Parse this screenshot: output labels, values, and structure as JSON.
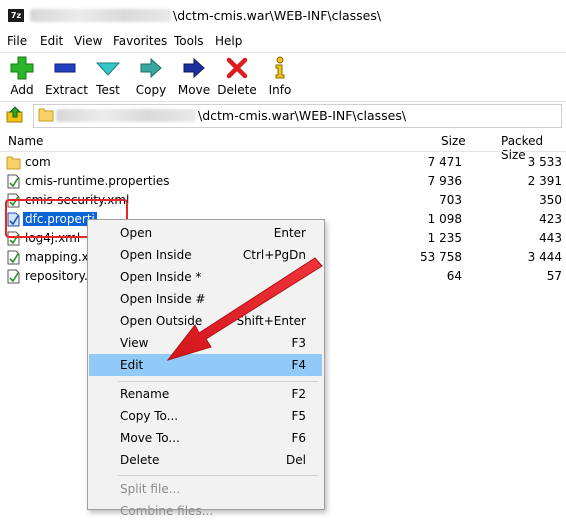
{
  "window": {
    "app_icon_text": "7z",
    "title_suffix": "\\dctm-cmis.war\\WEB-INF\\classes\\"
  },
  "menu": [
    "File",
    "Edit",
    "View",
    "Favorites",
    "Tools",
    "Help"
  ],
  "toolbar": [
    {
      "label": "Add",
      "icon": "plus-icon"
    },
    {
      "label": "Extract",
      "icon": "minus-icon"
    },
    {
      "label": "Test",
      "icon": "test-check-icon"
    },
    {
      "label": "Copy",
      "icon": "copy-arrow-icon"
    },
    {
      "label": "Move",
      "icon": "move-arrow-icon"
    },
    {
      "label": "Delete",
      "icon": "delete-x-icon"
    },
    {
      "label": "Info",
      "icon": "info-icon"
    }
  ],
  "address": {
    "path_suffix": "\\dctm-cmis.war\\WEB-INF\\classes\\"
  },
  "columns": {
    "name": "Name",
    "size": "Size",
    "packed": "Packed Size"
  },
  "files": [
    {
      "name": "com",
      "size": "7 471",
      "packed": "3 533",
      "type": "folder"
    },
    {
      "name": "cmis-runtime.properties",
      "size": "7 936",
      "packed": "2 391",
      "type": "file"
    },
    {
      "name": "cmis-security.xml",
      "size": "703",
      "packed": "350",
      "type": "file"
    },
    {
      "name": "dfc.properti",
      "size": "1 098",
      "packed": "423",
      "type": "file",
      "selected": true
    },
    {
      "name": "log4j.xml",
      "size": "1 235",
      "packed": "443",
      "type": "file"
    },
    {
      "name": "mapping.xr",
      "size": "53 758",
      "packed": "3 444",
      "type": "file"
    },
    {
      "name": "repository.p",
      "size": "64",
      "packed": "57",
      "type": "file"
    }
  ],
  "context_menu": {
    "group1": [
      {
        "label": "Open",
        "key": "Enter"
      },
      {
        "label": "Open Inside",
        "key": "Ctrl+PgDn"
      },
      {
        "label": "Open Inside *",
        "key": ""
      },
      {
        "label": "Open Inside #",
        "key": ""
      },
      {
        "label": "Open Outside",
        "key": "Shift+Enter"
      },
      {
        "label": "View",
        "key": "F3"
      },
      {
        "label": "Edit",
        "key": "F4",
        "highlighted": true
      }
    ],
    "group2": [
      {
        "label": "Rename",
        "key": "F2"
      },
      {
        "label": "Copy To...",
        "key": "F5"
      },
      {
        "label": "Move To...",
        "key": "F6"
      },
      {
        "label": "Delete",
        "key": "Del"
      }
    ],
    "group3": [
      {
        "label": "Split file...",
        "key": "",
        "disabled": true
      },
      {
        "label": "Combine files...",
        "key": "",
        "disabled": true
      }
    ]
  },
  "colors": {
    "selection": "#0a64d8",
    "menu_highlight": "#91c9f7",
    "annotation_red": "#e8262a"
  }
}
